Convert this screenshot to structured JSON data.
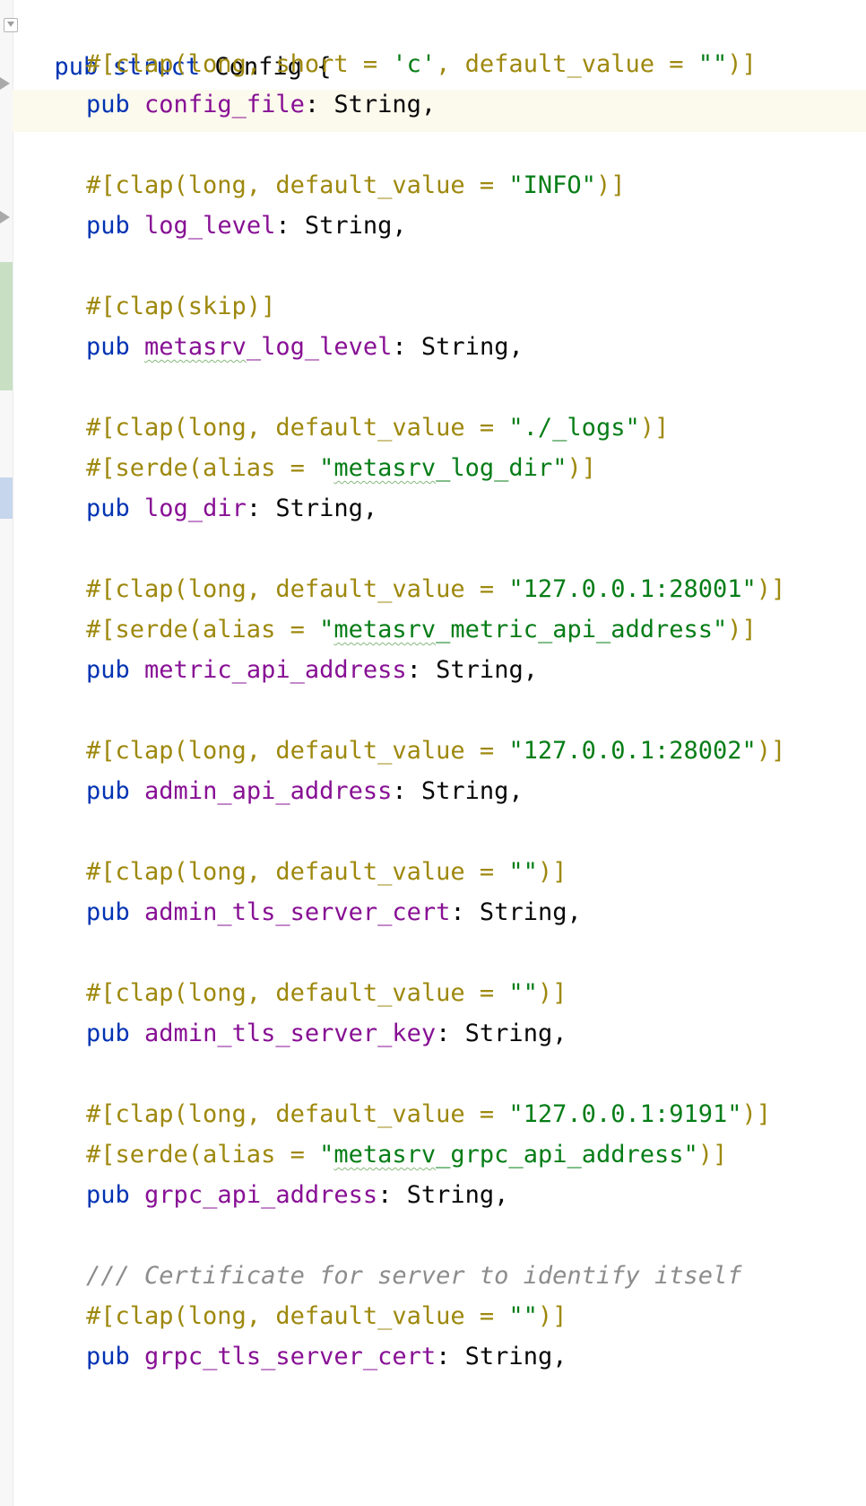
{
  "editor": {
    "struct_header": {
      "kw1": "pub",
      "kw2": "struct",
      "name": "Config",
      "brace": "{"
    },
    "lines": [
      {
        "kind": "attr",
        "text": "#[clap(long, short = 'c', default_value = \"\")]"
      },
      {
        "kind": "field",
        "pub": "pub",
        "name": "config_file",
        "rest": ": String,"
      },
      {
        "kind": "attr",
        "text": "#[clap(long, default_value = \"INFO\")]"
      },
      {
        "kind": "field",
        "pub": "pub",
        "name": "log_level",
        "rest": ": String,"
      },
      {
        "kind": "attr",
        "text": "#[clap(skip)]"
      },
      {
        "kind": "field",
        "pub": "pub",
        "name": "metasrv_log_level",
        "rest": ": String,"
      },
      {
        "kind": "attr",
        "text": "#[clap(long, default_value = \"./_logs\")]"
      },
      {
        "kind": "attr",
        "text": "#[serde(alias = \"metasrv_log_dir\")]"
      },
      {
        "kind": "field",
        "pub": "pub",
        "name": "log_dir",
        "rest": ": String,"
      },
      {
        "kind": "attr",
        "text": "#[clap(long, default_value = \"127.0.0.1:28001\")]"
      },
      {
        "kind": "attr",
        "text": "#[serde(alias = \"metasrv_metric_api_address\")]"
      },
      {
        "kind": "field",
        "pub": "pub",
        "name": "metric_api_address",
        "rest": ": String,"
      },
      {
        "kind": "attr",
        "text": "#[clap(long, default_value = \"127.0.0.1:28002\")]"
      },
      {
        "kind": "field",
        "pub": "pub",
        "name": "admin_api_address",
        "rest": ": String,"
      },
      {
        "kind": "attr",
        "text": "#[clap(long, default_value = \"\")]"
      },
      {
        "kind": "field",
        "pub": "pub",
        "name": "admin_tls_server_cert",
        "rest": ": String,"
      },
      {
        "kind": "attr",
        "text": "#[clap(long, default_value = \"\")]"
      },
      {
        "kind": "field",
        "pub": "pub",
        "name": "admin_tls_server_key",
        "rest": ": String,"
      },
      {
        "kind": "attr",
        "text": "#[clap(long, default_value = \"127.0.0.1:9191\")]"
      },
      {
        "kind": "attr",
        "text": "#[serde(alias = \"metasrv_grpc_api_address\")]"
      },
      {
        "kind": "field",
        "pub": "pub",
        "name": "grpc_api_address",
        "rest": ": String,"
      },
      {
        "kind": "comment",
        "text": "/// Certificate for server to identify itself"
      },
      {
        "kind": "attr",
        "text": "#[clap(long, default_value = \"\")]"
      },
      {
        "kind": "field",
        "pub": "pub",
        "name": "grpc_tls_server_cert",
        "rest": ": String,"
      }
    ]
  },
  "colors": {
    "keyword": "#0033b3",
    "field": "#871094",
    "attribute": "#9e880d",
    "string": "#067d17",
    "comment": "#8c8c8c",
    "caret_line": "#fcfaed",
    "gutter_added": "#c9dfc4",
    "gutter_modified": "#c6d6ec"
  },
  "icons": [
    "fold-icon",
    "fold-arrow-icon"
  ]
}
